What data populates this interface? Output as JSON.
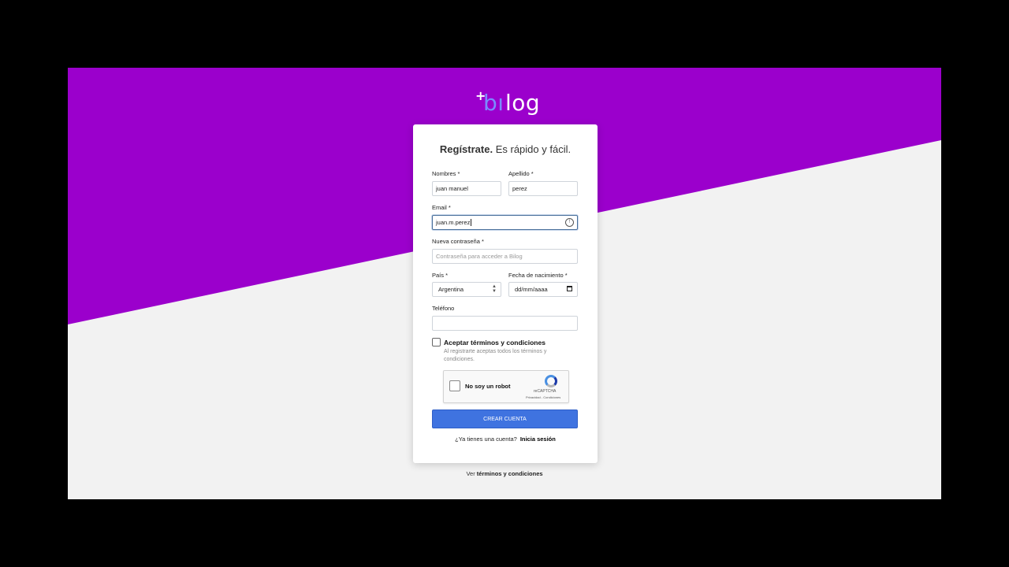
{
  "logo": {
    "plus": "+",
    "bi": "bı",
    "log": "log"
  },
  "title": {
    "bold": "Regístrate.",
    "rest": " Es rápido y fácil."
  },
  "form": {
    "nombres_label": "Nombres *",
    "nombres_value": "juan manuel",
    "apellido_label": "Apellido *",
    "apellido_value": "perez",
    "email_label": "Email *",
    "email_value": "juan.m.perez",
    "password_label": "Nueva contraseña *",
    "password_placeholder": "Contraseña para acceder a Bilog",
    "pais_label": "País *",
    "pais_value": "Argentina",
    "fecha_label": "Fecha de nacimiento *",
    "fecha_value": "dd/mm/aaaa",
    "telefono_label": "Teléfono",
    "telefono_value": "",
    "terms_label": "Aceptar términos y condiciones",
    "terms_desc": "Al registrarte aceptas todos los términos y condiciones."
  },
  "captcha": {
    "label": "No soy un robot",
    "brand": "reCAPTCHA",
    "links": "Privacidad - Condiciones"
  },
  "submit_label": "CREAR CUENTA",
  "login": {
    "question": "¿Ya tienes una cuenta?",
    "link": "Inicia sesión"
  },
  "footer": {
    "prefix": "Ver ",
    "link": "términos y condiciones"
  },
  "colors": {
    "purple": "#9b00cc",
    "button": "#3f73e0",
    "background": "#f2f2f2"
  }
}
